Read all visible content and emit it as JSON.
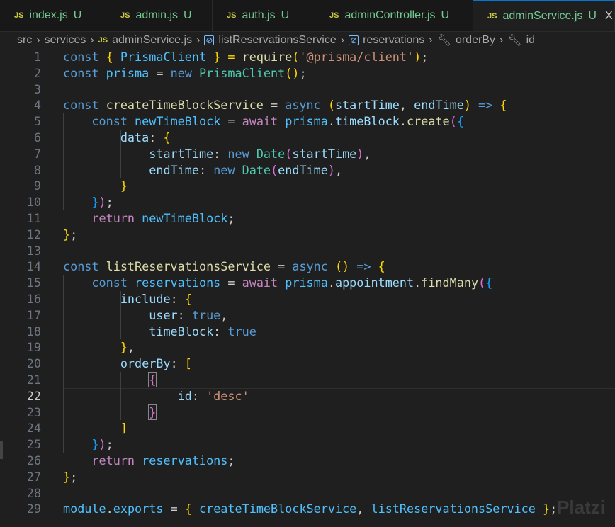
{
  "tabs": [
    {
      "label": "index.js",
      "status": "U"
    },
    {
      "label": "admin.js",
      "status": "U"
    },
    {
      "label": "auth.js",
      "status": "U"
    },
    {
      "label": "adminController.js",
      "status": "U"
    },
    {
      "label": "adminService.js",
      "status": "U",
      "active": true
    }
  ],
  "tab_icon": "JS",
  "close_icon": "X",
  "breadcrumb": [
    "src",
    "services",
    "adminService.js",
    "listReservationsService",
    "reservations",
    "orderBy",
    "id"
  ],
  "watermark": "Platzi",
  "current_line": 22,
  "colors": {
    "k": "#569cd6",
    "c": "#4fc1ff",
    "f": "#dcdcaa",
    "p": "#9cdcfe",
    "s": "#ce9178",
    "t": "#4ec9b0",
    "a": "#c586c0",
    "y": "#ffd700",
    "m": "#da70d6",
    "b": "#179fff",
    "w": "#cccccc"
  },
  "lines": [
    [
      [
        "const ",
        "k"
      ],
      [
        "{",
        "y"
      ],
      [
        " PrismaClient ",
        "c"
      ],
      [
        "} = ",
        "y"
      ],
      [
        "require",
        "f"
      ],
      [
        "(",
        "y"
      ],
      [
        "'@prisma/client'",
        "s"
      ],
      [
        ")",
        "y"
      ],
      [
        ";",
        "w"
      ]
    ],
    [
      [
        "const ",
        "k"
      ],
      [
        "prisma",
        "c"
      ],
      [
        " = ",
        "w"
      ],
      [
        "new ",
        "k"
      ],
      [
        "PrismaClient",
        "t"
      ],
      [
        "()",
        "y"
      ],
      [
        ";",
        "w"
      ]
    ],
    [],
    [
      [
        "const ",
        "k"
      ],
      [
        "createTimeBlockService",
        "f"
      ],
      [
        " = ",
        "w"
      ],
      [
        "async ",
        "k"
      ],
      [
        "(",
        "y"
      ],
      [
        "startTime",
        "p"
      ],
      [
        ", ",
        "w"
      ],
      [
        "endTime",
        "p"
      ],
      [
        ")",
        "y"
      ],
      [
        " => ",
        "k"
      ],
      [
        "{",
        "y"
      ]
    ],
    [
      [
        "    const ",
        "k"
      ],
      [
        "newTimeBlock",
        "c"
      ],
      [
        " = ",
        "w"
      ],
      [
        "await ",
        "a"
      ],
      [
        "prisma",
        "c"
      ],
      [
        ".",
        "w"
      ],
      [
        "timeBlock",
        "p"
      ],
      [
        ".",
        "w"
      ],
      [
        "create",
        "f"
      ],
      [
        "(",
        "m"
      ],
      [
        "{",
        "b"
      ]
    ],
    [
      [
        "        data",
        "p"
      ],
      [
        ": ",
        "w"
      ],
      [
        "{",
        "y"
      ]
    ],
    [
      [
        "            startTime",
        "p"
      ],
      [
        ": ",
        "w"
      ],
      [
        "new ",
        "k"
      ],
      [
        "Date",
        "t"
      ],
      [
        "(",
        "m"
      ],
      [
        "startTime",
        "p"
      ],
      [
        ")",
        "m"
      ],
      [
        ",",
        "w"
      ]
    ],
    [
      [
        "            endTime",
        "p"
      ],
      [
        ": ",
        "w"
      ],
      [
        "new ",
        "k"
      ],
      [
        "Date",
        "t"
      ],
      [
        "(",
        "m"
      ],
      [
        "endTime",
        "p"
      ],
      [
        ")",
        "m"
      ],
      [
        ",",
        "w"
      ]
    ],
    [
      [
        "        }",
        "y"
      ]
    ],
    [
      [
        "    }",
        "b"
      ],
      [
        ")",
        "m"
      ],
      [
        ";",
        "w"
      ]
    ],
    [
      [
        "    return ",
        "a"
      ],
      [
        "newTimeBlock",
        "c"
      ],
      [
        ";",
        "w"
      ]
    ],
    [
      [
        "}",
        "y"
      ],
      [
        ";",
        "w"
      ]
    ],
    [],
    [
      [
        "const ",
        "k"
      ],
      [
        "listReservationsService",
        "f"
      ],
      [
        " = ",
        "w"
      ],
      [
        "async ",
        "k"
      ],
      [
        "()",
        "y"
      ],
      [
        " => ",
        "k"
      ],
      [
        "{",
        "y"
      ]
    ],
    [
      [
        "    const ",
        "k"
      ],
      [
        "reservations",
        "c"
      ],
      [
        " = ",
        "w"
      ],
      [
        "await ",
        "a"
      ],
      [
        "prisma",
        "c"
      ],
      [
        ".",
        "w"
      ],
      [
        "appointment",
        "p"
      ],
      [
        ".",
        "w"
      ],
      [
        "findMany",
        "f"
      ],
      [
        "(",
        "m"
      ],
      [
        "{",
        "b"
      ]
    ],
    [
      [
        "        include",
        "p"
      ],
      [
        ": ",
        "w"
      ],
      [
        "{",
        "y"
      ]
    ],
    [
      [
        "            user",
        "p"
      ],
      [
        ": ",
        "w"
      ],
      [
        "true",
        "k"
      ],
      [
        ",",
        "w"
      ]
    ],
    [
      [
        "            timeBlock",
        "p"
      ],
      [
        ": ",
        "w"
      ],
      [
        "true",
        "k"
      ]
    ],
    [
      [
        "        }",
        "y"
      ],
      [
        ",",
        "w"
      ]
    ],
    [
      [
        "        orderBy",
        "p"
      ],
      [
        ": ",
        "w"
      ],
      [
        "[",
        "y"
      ]
    ],
    [
      [
        "            ",
        "w"
      ],
      [
        "{",
        "m",
        "box"
      ]
    ],
    [
      [
        "                id",
        "p"
      ],
      [
        ": ",
        "w"
      ],
      [
        "'desc'",
        "s"
      ]
    ],
    [
      [
        "            ",
        "w"
      ],
      [
        "}",
        "m",
        "box"
      ]
    ],
    [
      [
        "        ]",
        "y"
      ]
    ],
    [
      [
        "    }",
        "b"
      ],
      [
        ")",
        "m"
      ],
      [
        ";",
        "w"
      ]
    ],
    [
      [
        "    return ",
        "a"
      ],
      [
        "reservations",
        "c"
      ],
      [
        ";",
        "w"
      ]
    ],
    [
      [
        "}",
        "y"
      ],
      [
        ";",
        "w"
      ]
    ],
    [],
    [
      [
        "module",
        "c"
      ],
      [
        ".",
        "w"
      ],
      [
        "exports",
        "c"
      ],
      [
        " = ",
        "w"
      ],
      [
        "{",
        "y"
      ],
      [
        " createTimeBlockService",
        "c"
      ],
      [
        ", ",
        "w"
      ],
      [
        "listReservationsService ",
        "c"
      ],
      [
        "}",
        "y"
      ],
      [
        ";",
        "w"
      ]
    ]
  ]
}
